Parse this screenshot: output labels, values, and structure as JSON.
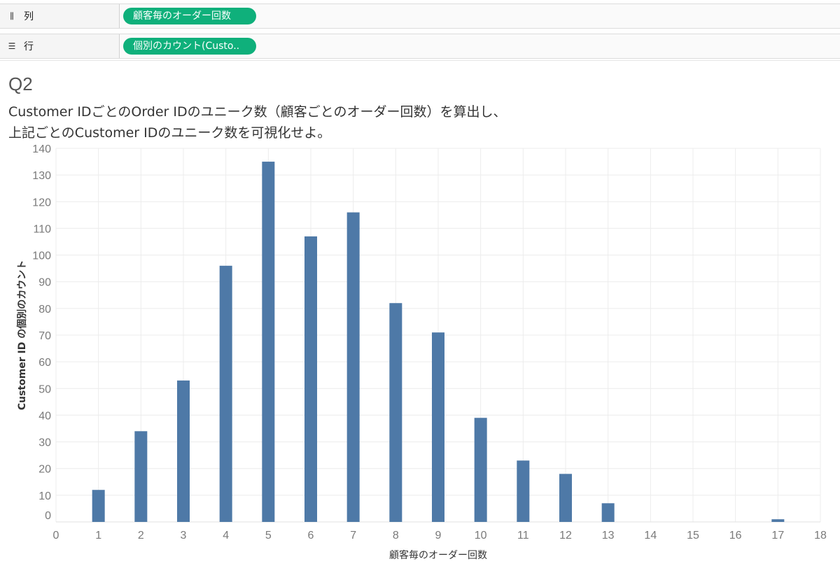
{
  "shelves": {
    "columns": {
      "icon": "columns-icon",
      "label": "列",
      "pill": "顧客毎のオーダー回数"
    },
    "rows": {
      "icon": "rows-icon",
      "label": "行",
      "pill": "個別のカウント(Custo.."
    }
  },
  "sheet": {
    "title": "Q2",
    "line1": "Customer IDごとのOrder IDのユニーク数（顧客ごとのオーダー回数）を算出し、",
    "line2": "上記ごとのCustomer IDのユニーク数を可視化せよ。"
  },
  "chart_data": {
    "type": "bar",
    "x": [
      1,
      2,
      3,
      4,
      5,
      6,
      7,
      8,
      9,
      10,
      11,
      12,
      13,
      17
    ],
    "values": [
      12,
      34,
      53,
      96,
      135,
      107,
      116,
      82,
      71,
      39,
      23,
      18,
      7,
      1
    ],
    "xlabel": "顧客毎のオーダー回数",
    "ylabel": "Customer ID の個別のカウント",
    "xlim": [
      0,
      18
    ],
    "ylim": [
      0,
      140
    ],
    "x_ticks": [
      0,
      1,
      2,
      3,
      4,
      5,
      6,
      7,
      8,
      9,
      10,
      11,
      12,
      13,
      14,
      15,
      16,
      17,
      18
    ],
    "y_ticks": [
      0,
      10,
      20,
      30,
      40,
      50,
      60,
      70,
      80,
      90,
      100,
      110,
      120,
      130,
      140
    ],
    "bar_color": "#4e79a7",
    "grid": true
  }
}
